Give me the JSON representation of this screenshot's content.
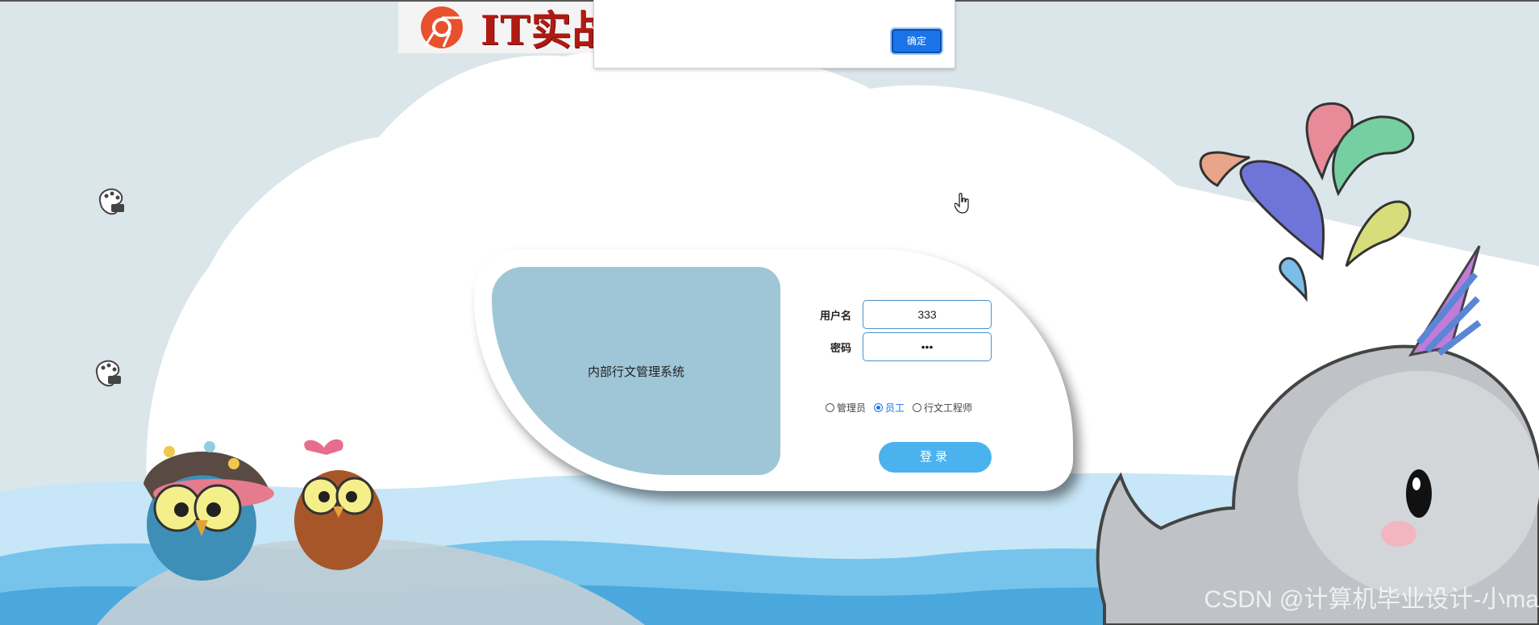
{
  "logo": {
    "text": "IT实战课堂",
    "icon": "chrome-like-logo-icon"
  },
  "alert": {
    "ok_label": "确定"
  },
  "login": {
    "system_title": "内部行文管理系统",
    "username_label": "用户名",
    "username_value": "333",
    "password_label": "密码",
    "password_value": "•••",
    "roles": [
      {
        "label": "管理员",
        "selected": false
      },
      {
        "label": "员工",
        "selected": true
      },
      {
        "label": "行文工程师",
        "selected": false
      }
    ],
    "submit_label": "登录"
  },
  "watermark": "CSDN @计算机毕业设计-小ma",
  "colors": {
    "panel": "#9fc6d6",
    "button": "#4ab3ee",
    "accent": "#1a73e8",
    "logo_red": "#b01a12"
  }
}
